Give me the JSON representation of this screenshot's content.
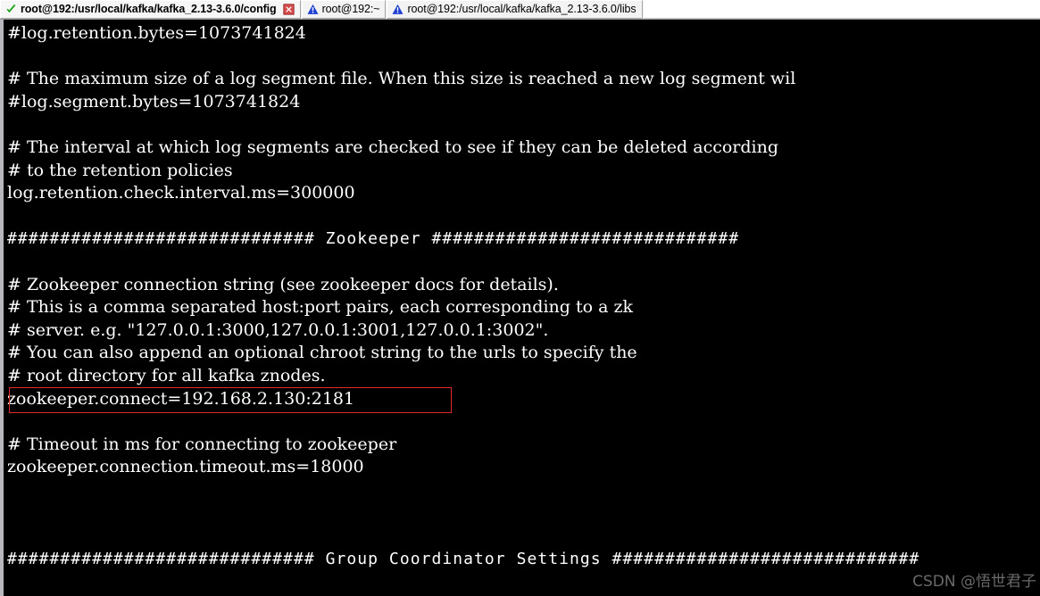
{
  "window": {
    "kind": "terminal-emulator",
    "background_color": "#000000",
    "foreground_color": "#ffffff"
  },
  "tabbar": {
    "tabs": [
      {
        "label": "root@192:/usr/local/kafka/kafka_2.13-3.6.0/config",
        "icon": "green-check-icon",
        "active": true,
        "has_close": true,
        "close_icon": "red-close-icon"
      },
      {
        "label": "root@192:~",
        "icon": "blue-warning-triangle-icon",
        "active": false,
        "has_close": false
      },
      {
        "label": "root@192:/usr/local/kafka/kafka_2.13-3.6.0/libs",
        "icon": "blue-warning-triangle-icon",
        "active": false,
        "has_close": false
      }
    ]
  },
  "terminal": {
    "lines": [
      "#log.retention.bytes=1073741824",
      "",
      "# The maximum size of a log segment file. When this size is reached a new log segment wil",
      "#log.segment.bytes=1073741824",
      "",
      "# The interval at which log segments are checked to see if they can be deleted according",
      "# to the retention policies",
      "log.retention.check.interval.ms=300000",
      "",
      "############################# Zookeeper #############################",
      "",
      "# Zookeeper connection string (see zookeeper docs for details).",
      "# This is a comma separated host:port pairs, each corresponding to a zk",
      "# server. e.g. \"127.0.0.1:3000,127.0.0.1:3001,127.0.0.1:3002\".",
      "# You can also append an optional chroot string to the urls to specify the",
      "# root directory for all kafka znodes.",
      "zookeeper.connect=192.168.2.130:2181",
      "",
      "# Timeout in ms for connecting to zookeeper",
      "zookeeper.connection.timeout.ms=18000",
      "",
      "",
      "",
      "############################# Group Coordinator Settings #############################"
    ],
    "highlighted_line_index": 16,
    "highlight_color": "#e02a2a"
  },
  "watermark": {
    "text": "CSDN @悟世君子",
    "color": "#8d8d8d"
  }
}
